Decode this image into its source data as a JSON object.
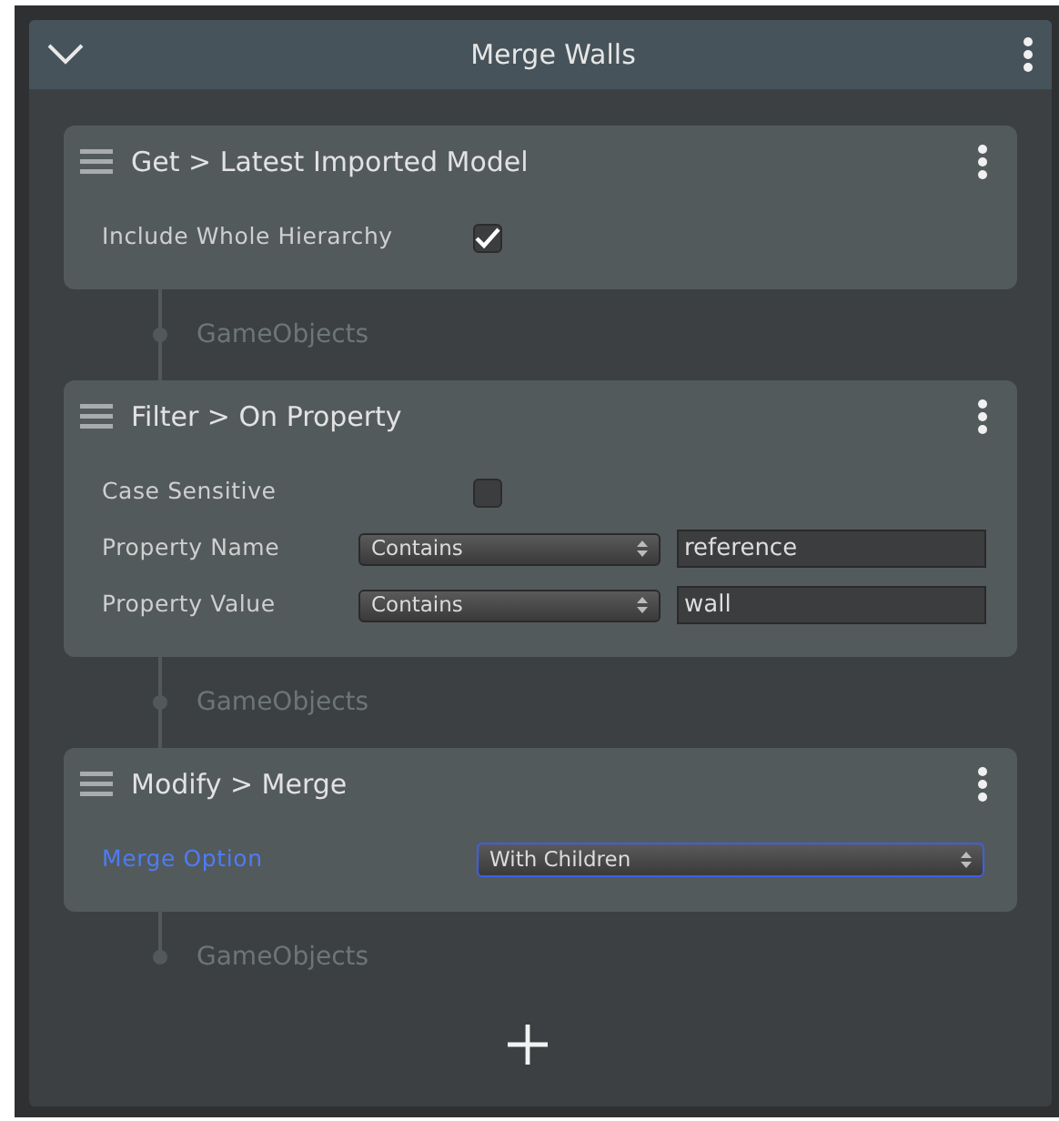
{
  "panel": {
    "title": "Merge Walls",
    "expanded": true
  },
  "steps": [
    {
      "title": "Get > Latest Imported Model",
      "output": "GameObjects",
      "fields": [
        {
          "kind": "checkbox",
          "label": "Include Whole Hierarchy",
          "checked": true,
          "focused": false
        }
      ]
    },
    {
      "title": "Filter > On Property",
      "output": "GameObjects",
      "fields": [
        {
          "kind": "checkbox",
          "label": "Case Sensitive",
          "checked": false,
          "focused": false
        },
        {
          "kind": "match",
          "label": "Property Name",
          "option": "Contains",
          "value": "reference",
          "focused": false
        },
        {
          "kind": "match",
          "label": "Property Value",
          "option": "Contains",
          "value": "wall",
          "focused": false
        }
      ]
    },
    {
      "title": "Modify > Merge",
      "output": "GameObjects",
      "fields": [
        {
          "kind": "dropdown",
          "label": "Merge Option",
          "option": "With Children",
          "focused": true
        }
      ]
    }
  ]
}
